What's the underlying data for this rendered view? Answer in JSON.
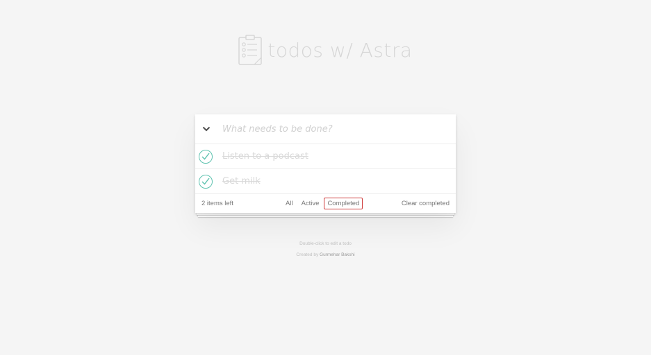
{
  "header": {
    "title": "todos w/ Astra",
    "logo_icon": "clipboard-checklist-icon"
  },
  "new_todo": {
    "placeholder": "What needs to be done?",
    "value": "",
    "toggle_icon": "chevron-down-icon"
  },
  "todos": [
    {
      "label": "Listen to a podcast",
      "completed": true
    },
    {
      "label": "Get milk",
      "completed": true
    }
  ],
  "footer": {
    "count_text": "2 items left",
    "filters": [
      {
        "label": "All",
        "selected": false
      },
      {
        "label": "Active",
        "selected": false
      },
      {
        "label": "Completed",
        "selected": true
      }
    ],
    "clear_label": "Clear completed"
  },
  "info": {
    "hint": "Double-click to edit a todo",
    "created_prefix": "Created by",
    "author": "Gurmehar Bakshi"
  },
  "colors": {
    "check": "#5dc2af",
    "selected_filter_border": "#cf3b3b",
    "title": "#d6d6d6"
  }
}
